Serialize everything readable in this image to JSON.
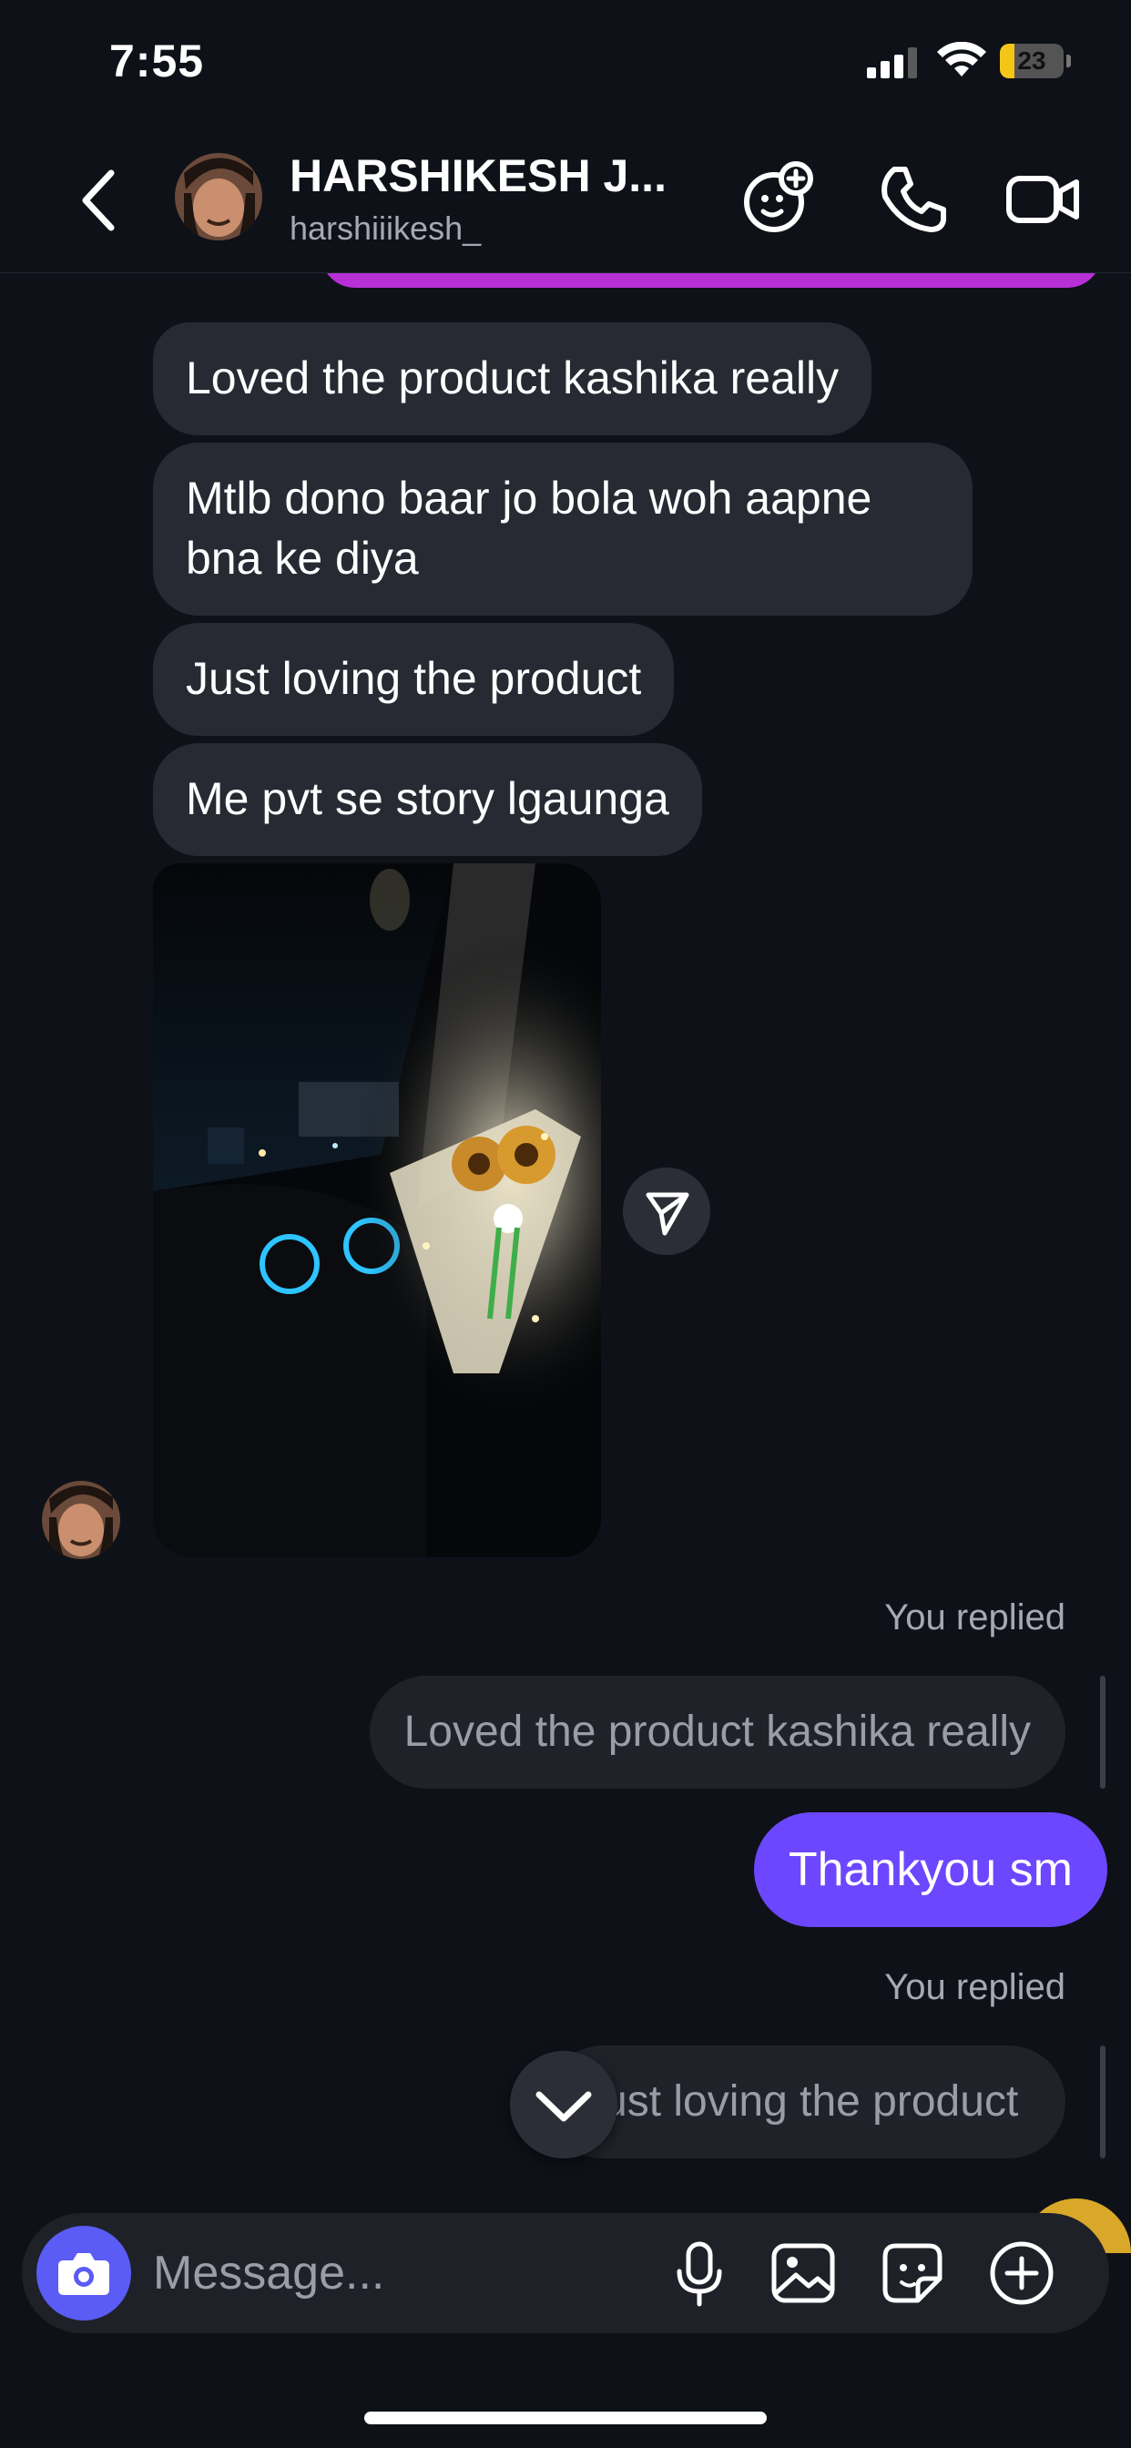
{
  "status_bar": {
    "time": "7:55",
    "battery_level": "23"
  },
  "header": {
    "contact_name": "HARSHIKESH J...",
    "username": "harshiiikesh_"
  },
  "messages": {
    "received": [
      "Loved the product kashika really",
      "Mtlb dono baar jo bola woh aapne bna ke diya",
      "Just loving the product",
      "Me pvt se story lgaunga"
    ],
    "replies": [
      {
        "label": "You replied",
        "quoted": "Loved the product kashika really",
        "text": "Thankyou sm"
      },
      {
        "label": "You replied",
        "quoted": "Just loving the product"
      }
    ]
  },
  "composer": {
    "placeholder": "Message..."
  },
  "colors": {
    "background": "#0e1118",
    "received_bubble": "#272a33",
    "sent_bubble": "#6c47ff",
    "camera_button": "#5b5bf5",
    "previous_bubble": "#b730d6",
    "battery": "#f5c518"
  },
  "icons": [
    "back-icon",
    "effects-icon",
    "phone-icon",
    "video-icon",
    "share-icon",
    "chevron-down-icon",
    "camera-icon",
    "microphone-icon",
    "gallery-icon",
    "sticker-icon",
    "plus-icon"
  ]
}
